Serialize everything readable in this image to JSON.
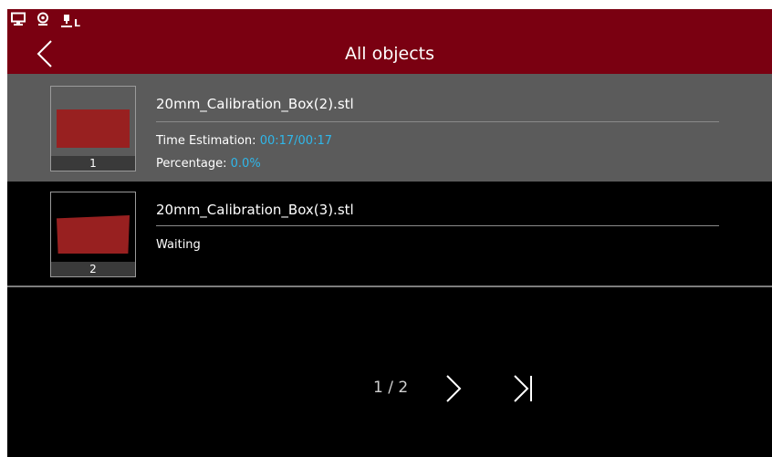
{
  "header": {
    "title": "All objects",
    "accent_color": "#7a0011",
    "status_icons": [
      "monitor-icon",
      "webcam-icon",
      "usb-device-icon"
    ],
    "status_suffix": "L"
  },
  "objects": [
    {
      "index": "1",
      "filename": "20mm_Calibration_Box(2).stl",
      "time_label": "Time Estimation: ",
      "time_value": "00:17/00:17",
      "percent_label": "Percentage: ",
      "percent_value": "0.0%",
      "selected": true
    },
    {
      "index": "2",
      "filename": "20mm_Calibration_Box(3).stl",
      "status": "Waiting",
      "selected": false
    }
  ],
  "pagination": {
    "indicator": "1 / 2"
  }
}
